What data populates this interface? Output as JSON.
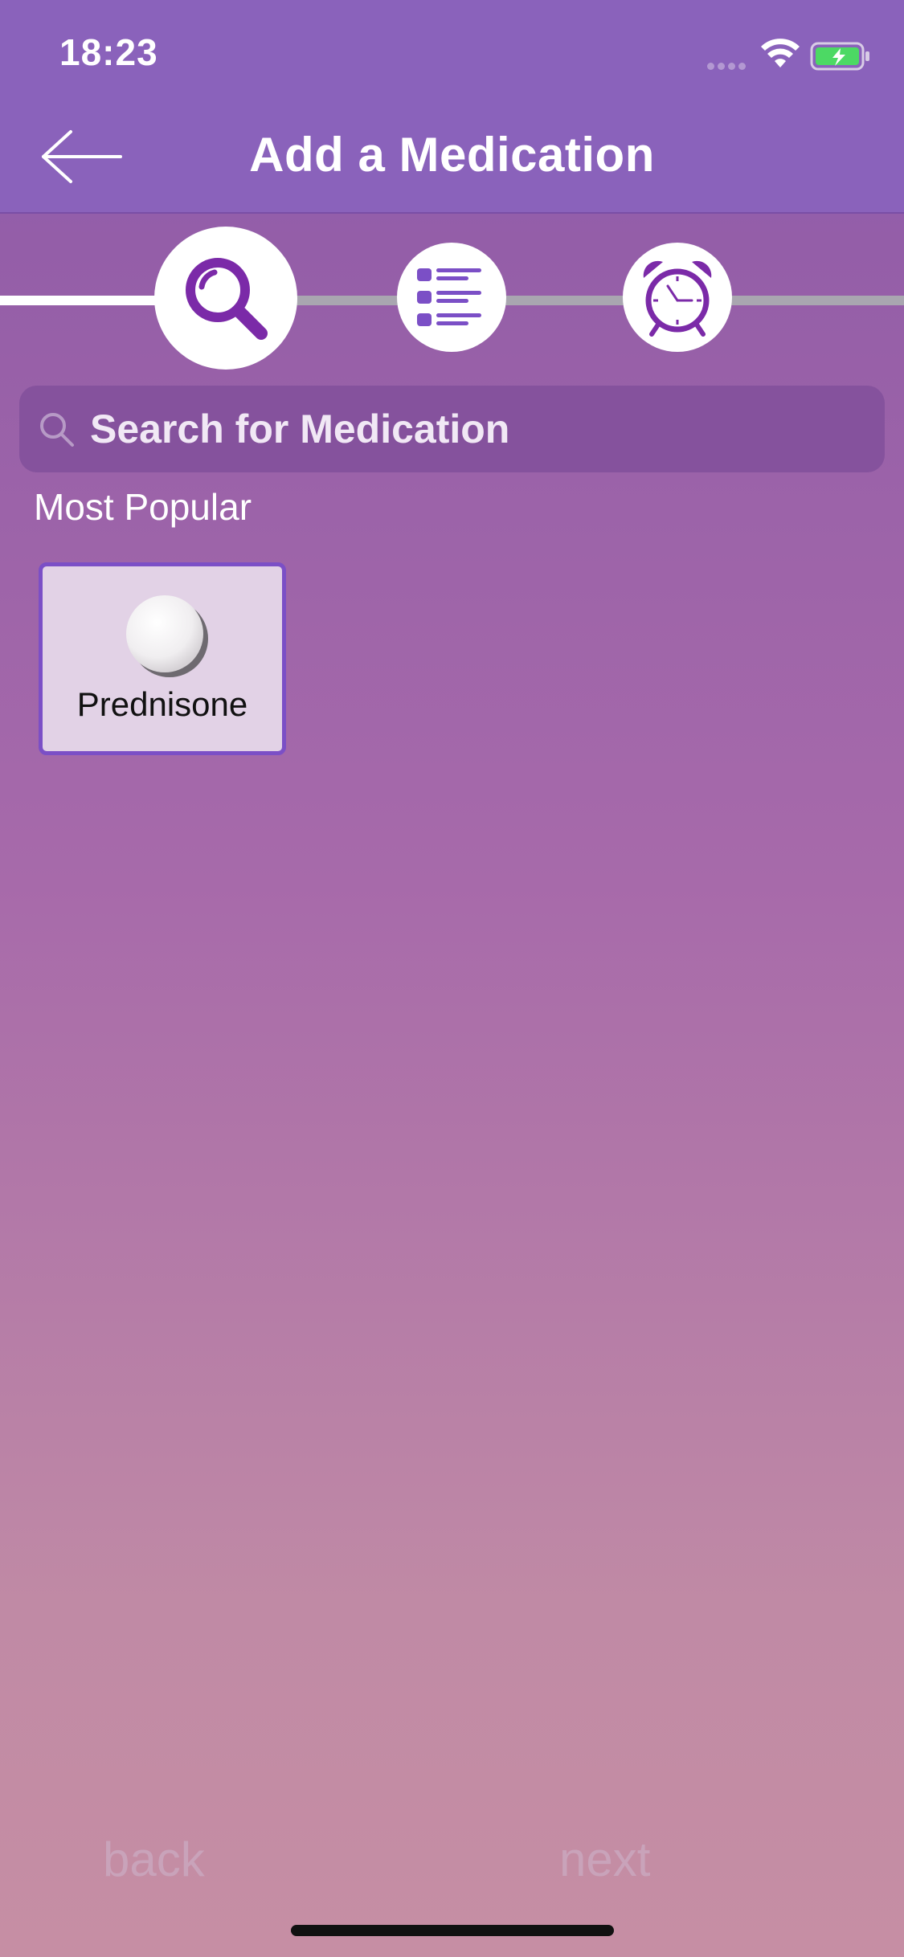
{
  "status_bar": {
    "time": "18:23"
  },
  "header": {
    "title": "Add a Medication",
    "back_icon": "arrow-left-icon"
  },
  "stepper": {
    "current_step": 1,
    "steps": [
      {
        "icon": "search-icon",
        "active": true
      },
      {
        "icon": "list-icon",
        "active": false
      },
      {
        "icon": "alarm-clock-icon",
        "active": false
      }
    ]
  },
  "search": {
    "placeholder": "Search for Medication",
    "value": ""
  },
  "popular": {
    "label": "Most Popular",
    "items": [
      {
        "name": "Prednisone",
        "icon": "pill-icon"
      }
    ]
  },
  "footer": {
    "back_label": "back",
    "next_label": "next"
  },
  "colors": {
    "header": "#8a62bb",
    "accent": "#7b2aa8",
    "card_border": "#7b4fc6",
    "nav_text": "#c9a3ba"
  }
}
